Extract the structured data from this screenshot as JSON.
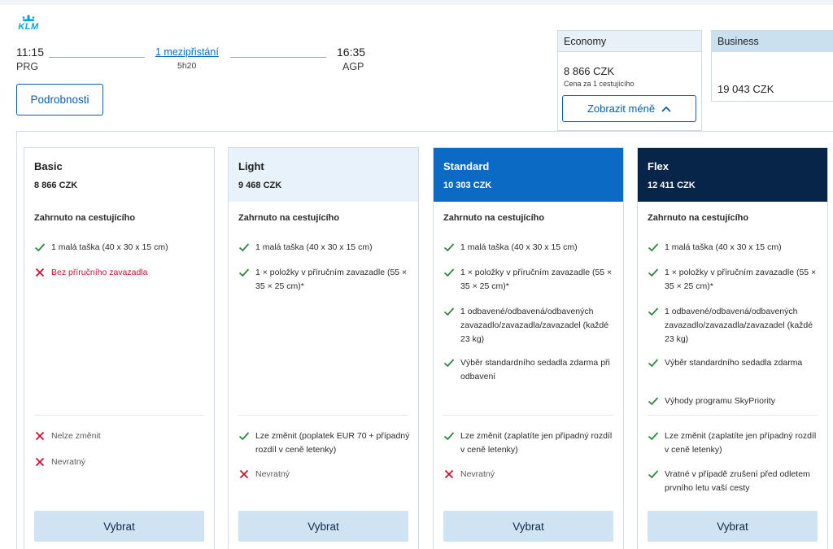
{
  "brand": {
    "logo_text": "KLM",
    "color": "#00a1de"
  },
  "flight": {
    "departure_time": "11:15",
    "departure_code": "PRG",
    "stops": "1 mezipřistání",
    "duration": "5h20",
    "arrival_time": "16:35",
    "arrival_code": "AGP",
    "details_label": "Podrobnosti"
  },
  "cabins": {
    "economy": {
      "label": "Economy",
      "price": "8 866 CZK",
      "per_passenger": "Cena za 1 cestujícího",
      "toggle_label": "Zobrazit méně"
    },
    "business": {
      "label": "Business",
      "price": "19 043 CZK"
    }
  },
  "fares": [
    {
      "name": "Basic",
      "price": "8 866 CZK",
      "included_label": "Zahrnuto na cestujícího",
      "features": [
        {
          "icon": "check-icon",
          "text": "1 malá taška (40 x 30 x 15 cm)",
          "style": "normal"
        },
        {
          "icon": "cross-icon",
          "text": "Bez příručního zavazadla",
          "style": "red"
        }
      ],
      "conditions": [
        {
          "icon": "cross-icon",
          "text": "Nelze změnit",
          "style": "gray"
        },
        {
          "icon": "cross-icon",
          "text": "Nevratný",
          "style": "gray"
        }
      ],
      "select_label": "Vybrat"
    },
    {
      "name": "Light",
      "price": "9 468 CZK",
      "included_label": "Zahrnuto na cestujícího",
      "features": [
        {
          "icon": "check-icon",
          "text": "1 malá taška (40 x 30 x 15 cm)",
          "style": "normal"
        },
        {
          "icon": "check-icon",
          "text": "1 × položky v příručním zavazadle (55 × 35 × 25 cm)*",
          "style": "normal"
        }
      ],
      "conditions": [
        {
          "icon": "check-icon",
          "text": "Lze změnit (poplatek EUR 70 + případný rozdíl v ceně letenky)",
          "style": "normal"
        },
        {
          "icon": "cross-icon",
          "text": "Nevratný",
          "style": "gray"
        }
      ],
      "select_label": "Vybrat"
    },
    {
      "name": "Standard",
      "price": "10 303 CZK",
      "included_label": "Zahrnuto na cestujícího",
      "features": [
        {
          "icon": "check-icon",
          "text": "1 malá taška (40 x 30 x 15 cm)",
          "style": "normal"
        },
        {
          "icon": "check-icon",
          "text": "1 × položky v příručním zavazadle (55 × 35 × 25 cm)*",
          "style": "normal"
        },
        {
          "icon": "check-icon",
          "text": "1 odbavené/odbavená/odbavených zavazadlo/zavazadla/zavazadel (každé 23 kg)",
          "style": "normal"
        },
        {
          "icon": "check-icon",
          "text": "Výběr standardního sedadla zdarma při odbavení",
          "style": "normal"
        }
      ],
      "conditions": [
        {
          "icon": "check-icon",
          "text": "Lze změnit (zaplatíte jen případný rozdíl v ceně letenky)",
          "style": "normal"
        },
        {
          "icon": "cross-icon",
          "text": "Nevratný",
          "style": "gray"
        }
      ],
      "select_label": "Vybrat"
    },
    {
      "name": "Flex",
      "price": "12 411 CZK",
      "included_label": "Zahrnuto na cestujícího",
      "features": [
        {
          "icon": "check-icon",
          "text": "1 malá taška (40 x 30 x 15 cm)",
          "style": "normal"
        },
        {
          "icon": "check-icon",
          "text": "1 × položky v příručním zavazadle (55 × 35 × 25 cm)*",
          "style": "normal"
        },
        {
          "icon": "check-icon",
          "text": "1 odbavené/odbavená/odbavených zavazadlo/zavazadla/zavazadel (každé 23 kg)",
          "style": "normal"
        },
        {
          "icon": "check-icon",
          "text": "Výběr standardního sedadla zdarma",
          "style": "normal"
        },
        {
          "icon": "check-icon",
          "text": "Výhody programu SkyPriority",
          "style": "normal"
        }
      ],
      "conditions": [
        {
          "icon": "check-icon",
          "text": "Lze změnit (zaplatíte jen případný rozdíl v ceně letenky)",
          "style": "normal"
        },
        {
          "icon": "check-icon",
          "text": "Vratné v případě zrušení před odletem prvního letu vaší cesty",
          "style": "normal"
        }
      ],
      "select_label": "Vybrat"
    }
  ],
  "colors": {
    "check": "#2e8540",
    "cross": "#c8102e",
    "standard_header": "#0b6bc4",
    "flex_header": "#072548",
    "select_button": "#cfe3f2"
  }
}
